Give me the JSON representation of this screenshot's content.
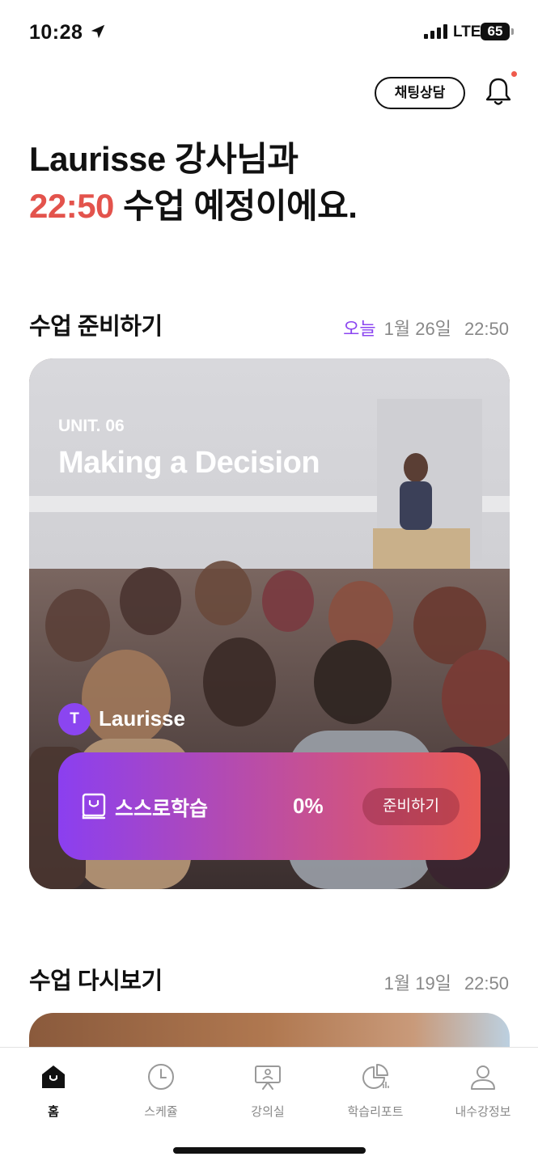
{
  "status_bar": {
    "time": "10:28",
    "network": "LTE",
    "battery": "65"
  },
  "header": {
    "chat_button": "채팅상담"
  },
  "headline": {
    "line1": "Laurisse 강사님과",
    "time": "22:50",
    "line2_rest": " 수업 예정이에요."
  },
  "upcoming": {
    "section_title": "수업 준비하기",
    "today_label": "오늘",
    "date": "1월 26일",
    "time": "22:50",
    "card": {
      "unit": "UNIT. 06",
      "title": "Making a Decision",
      "teacher_initial": "T",
      "teacher_name": "Laurisse",
      "self_study_label": "스스로학습",
      "progress": "0%",
      "prepare_button": "준비하기"
    }
  },
  "review": {
    "section_title": "수업 다시보기",
    "date": "1월 19일",
    "time": "22:50"
  },
  "tabbar": {
    "items": [
      {
        "label": "홈",
        "icon": "home-icon",
        "active": true
      },
      {
        "label": "스케쥴",
        "icon": "clock-icon",
        "active": false
      },
      {
        "label": "강의실",
        "icon": "classroom-icon",
        "active": false
      },
      {
        "label": "학습리포트",
        "icon": "report-chart-icon",
        "active": false
      },
      {
        "label": "내수강정보",
        "icon": "user-icon",
        "active": false
      }
    ]
  },
  "colors": {
    "accent_purple": "#8b45f0",
    "accent_red": "#e3534c",
    "gradient_start": "#8b3ff0",
    "gradient_end": "#e85a55"
  }
}
